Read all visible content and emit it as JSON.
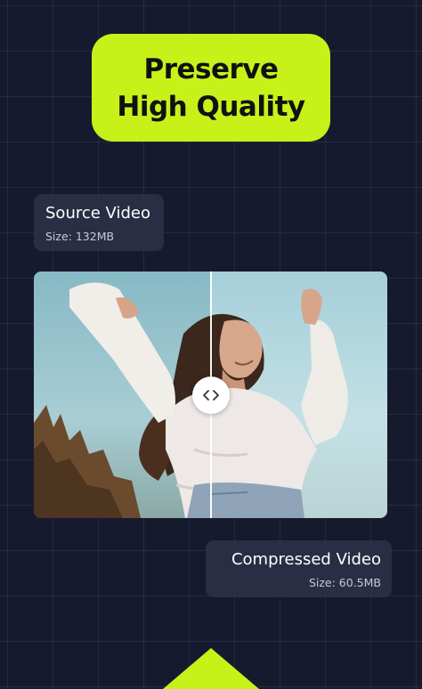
{
  "headline": {
    "line1": "Preserve",
    "line2": "High Quality"
  },
  "source_card": {
    "title": "Source Video",
    "size": "Size: 132MB"
  },
  "compressed_card": {
    "title": "Compressed Video",
    "size": "Size: 60.5MB"
  },
  "comparison": {
    "handle_icon": "chevron-left-right-icon",
    "split_position": 0.5
  },
  "colors": {
    "accent": "#c8f11a",
    "background": "#161a2e",
    "card": "#2c3046"
  }
}
